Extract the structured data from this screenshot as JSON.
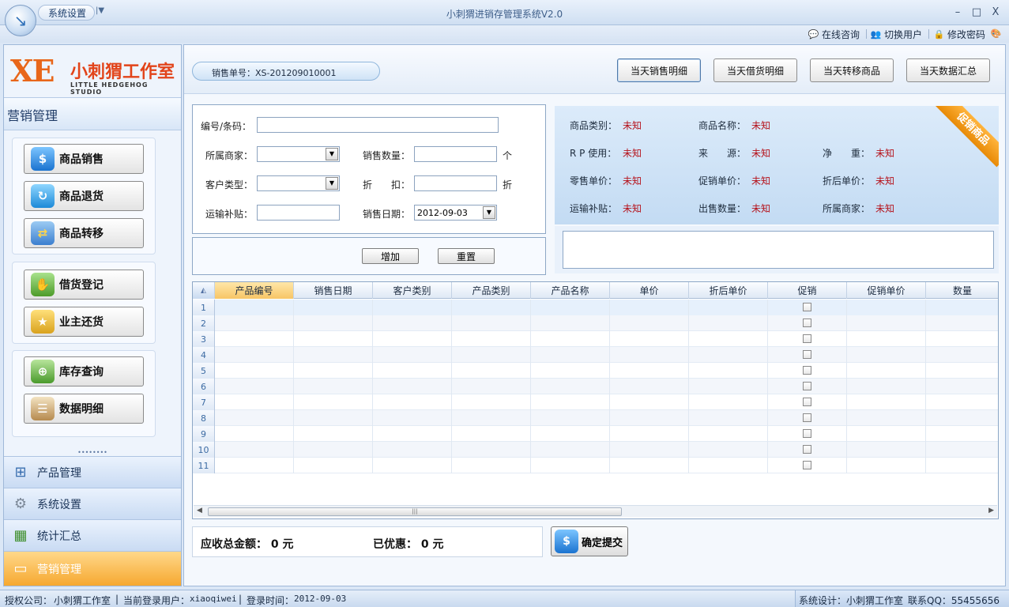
{
  "window": {
    "title": "小刺猬进销存管理系统V2.0",
    "menu_button": "系统设置",
    "controls": [
      "–",
      "□",
      "X"
    ]
  },
  "toplinks": [
    {
      "label": "在线咨询",
      "icon": "chat-icon"
    },
    {
      "label": "切换用户",
      "icon": "switch-user-icon"
    },
    {
      "label": "修改密码",
      "icon": "lock-icon"
    }
  ],
  "logo": {
    "mark": "XE",
    "name": "小刺猬工作室",
    "tagline": "LITTLE HEDGEHOG STUDIO"
  },
  "sidebar": {
    "header": "营销管理",
    "groups": [
      [
        {
          "label": "商品销售",
          "icon": "sale-icon",
          "color": "#2d8be0"
        },
        {
          "label": "商品退货",
          "icon": "return-icon",
          "color": "#1f9ae8"
        },
        {
          "label": "商品转移",
          "icon": "transfer-icon",
          "color": "#3b8fd8"
        }
      ],
      [
        {
          "label": "借货登记",
          "icon": "loan-icon",
          "color": "#5aa33a"
        },
        {
          "label": "业主还货",
          "icon": "repay-icon",
          "color": "#d9a21d"
        }
      ],
      [
        {
          "label": "库存查询",
          "icon": "inventory-search-icon",
          "color": "#4a9a2c"
        },
        {
          "label": "数据明细",
          "icon": "data-list-icon",
          "color": "#9a6a2c"
        }
      ]
    ],
    "accordion": [
      {
        "label": "产品管理",
        "icon": "org-chart-icon",
        "active": false
      },
      {
        "label": "系统设置",
        "icon": "gear-icon",
        "active": false
      },
      {
        "label": "统计汇总",
        "icon": "spreadsheet-icon",
        "active": false
      },
      {
        "label": "营销管理",
        "icon": "wallet-icon",
        "active": true
      }
    ]
  },
  "order": {
    "label": "销售单号：XS-201209010001"
  },
  "top_buttons": [
    "当天销售明细",
    "当天借货明细",
    "当天转移商品",
    "当天数据汇总"
  ],
  "form": {
    "code_label": "编号/条码：",
    "code_value": "",
    "merchant_label": "所属商家：",
    "merchant_value": "",
    "qty_label": "销售数量：",
    "qty_value": "",
    "qty_unit": "个",
    "customer_type_label": "客户类型：",
    "customer_type_value": "",
    "discount_label": "折　　扣：",
    "discount_value": "",
    "discount_unit": "折",
    "subsidy_label": "运输补贴：",
    "subsidy_value": "",
    "date_label": "销售日期：",
    "date_value": "2012-09-03",
    "add_button": "增加",
    "reset_button": "重置"
  },
  "info": {
    "ribbon": "促销商品",
    "fields": [
      {
        "label": "商品类别：",
        "value": "未知"
      },
      {
        "label": "商品名称：",
        "value": "未知"
      },
      {
        "label": "R P 使用：",
        "value": "未知"
      },
      {
        "label": "来　　源：",
        "value": "未知"
      },
      {
        "label": "净　　重：",
        "value": "未知"
      },
      {
        "label": "零售单价：",
        "value": "未知"
      },
      {
        "label": "促销单价：",
        "value": "未知"
      },
      {
        "label": "折后单价：",
        "value": "未知"
      },
      {
        "label": "运输补贴：",
        "value": "未知"
      },
      {
        "label": "出售数量：",
        "value": "未知"
      },
      {
        "label": "所属商家：",
        "value": "未知"
      }
    ]
  },
  "grid": {
    "columns": [
      "产品编号",
      "销售日期",
      "客户类别",
      "产品类别",
      "产品名称",
      "单价",
      "折后单价",
      "促销",
      "促销单价",
      "数量"
    ],
    "rows": [
      "1",
      "2",
      "3",
      "4",
      "5",
      "6",
      "7",
      "8",
      "9",
      "10",
      "11"
    ]
  },
  "totals": {
    "receivable": "应收总金额： 0 元",
    "discounted": "已优惠： 0 元",
    "submit": "确定提交"
  },
  "status": {
    "company_label": "授权公司：",
    "company": "小刺猬工作室",
    "user_label": "当前登录用户：",
    "user": "xiaoqiwei",
    "login_label": "登录时间：",
    "login_time": "2012-09-03",
    "design": "系统设计：小刺猬工作室",
    "qq": "联系QQ：55455656"
  }
}
